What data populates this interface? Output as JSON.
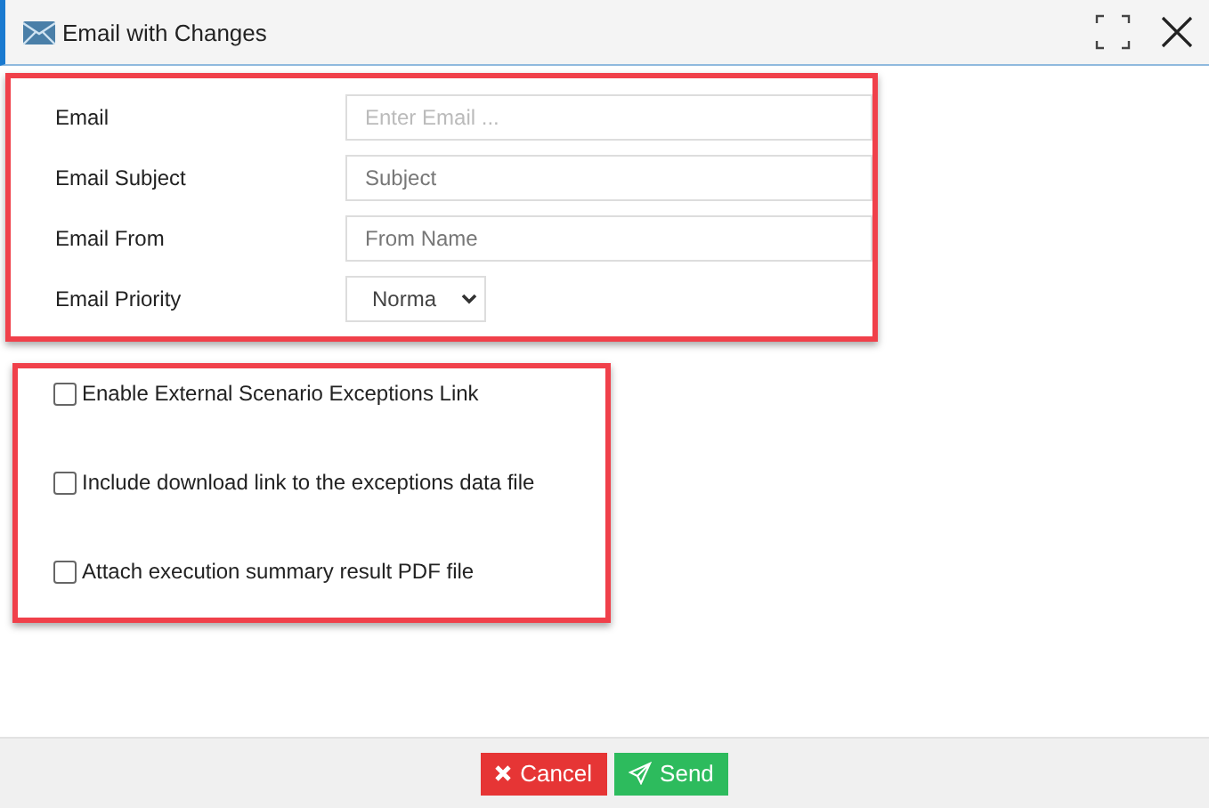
{
  "window": {
    "title": "Email with Changes"
  },
  "fields": [
    {
      "kind": "input",
      "label": "Email",
      "placeholder": "Enter Email ..."
    },
    {
      "kind": "input",
      "label": "Email Subject",
      "placeholder": "Subject"
    },
    {
      "kind": "input",
      "label": "Email From",
      "placeholder": "From Name"
    },
    {
      "kind": "select",
      "label": "Email Priority",
      "value": "Norma"
    }
  ],
  "options": [
    {
      "label": "Enable External Scenario Exceptions Link",
      "checked": false
    },
    {
      "label": "Include download link to the exceptions data file",
      "checked": false
    },
    {
      "label": "Attach execution summary result PDF file",
      "checked": false
    }
  ],
  "buttons": [
    {
      "kind": "cancel",
      "label": "Cancel"
    },
    {
      "kind": "send",
      "label": "Send"
    }
  ]
}
